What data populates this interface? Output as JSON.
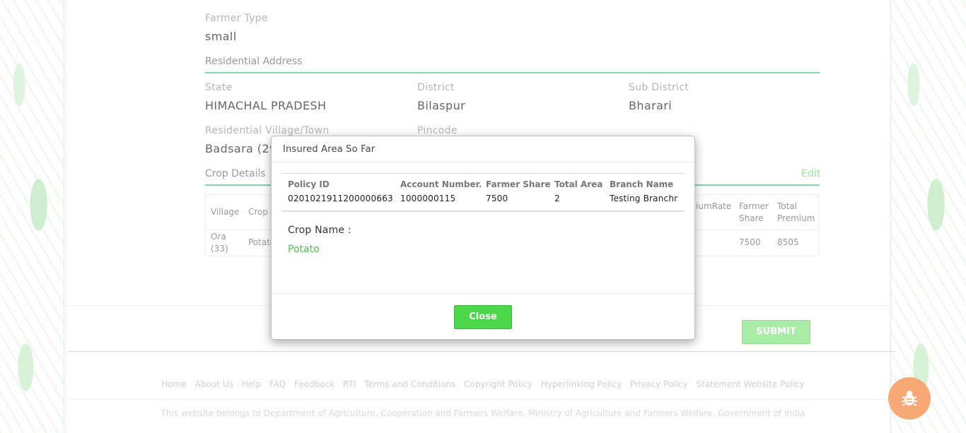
{
  "farmer": {
    "type_label": "Farmer Type",
    "type_value": "small"
  },
  "address": {
    "section_title": "Residential Address",
    "state_label": "State",
    "state_value": "HIMACHAL PRADESH",
    "district_label": "District",
    "district_value": "Bilaspur",
    "subdistrict_label": "Sub District",
    "subdistrict_value": "Bharari",
    "village_label": "Residential Village/Town",
    "village_value": "Badsara (29",
    "pincode_label": "Pincode"
  },
  "crop_details": {
    "section_title": "Crop Details",
    "edit_label": "Edit",
    "columns": [
      "Village",
      "Crop",
      "iumRate",
      "Farmer Share",
      "Total Premium"
    ],
    "row": {
      "village": "Ora (33)",
      "crop": "Potato",
      "farmer_share": "7500",
      "total_premium": "8505"
    }
  },
  "modal": {
    "title": "Insured Area So Far",
    "columns": [
      "Policy ID",
      "Account Number.",
      "Farmer Share",
      "Total Area",
      "Branch Name"
    ],
    "row": [
      "0201021911200000663",
      "1000000115",
      "7500",
      "2",
      "Testing Branchr"
    ],
    "crop_label": "Crop Name :",
    "crop_value": "Potato",
    "close_label": "Close"
  },
  "submit_label": "SUBMIT",
  "footer": {
    "links": [
      "Home",
      "About Us",
      "Help",
      "FAQ",
      "Feedback",
      "RTI",
      "Terms and Conditions",
      "Copyright Policy",
      "Hyperlinking Policy",
      "Privacy Policy",
      "Statement Website Policy"
    ],
    "note": "This website belongs to Department of Agriculture, Cooperation and Farmers Welfare, Ministry of Agriculture and Farmers Welfare, Government of India"
  },
  "icons": {
    "bug": "bug-icon"
  },
  "colors": {
    "accent_green": "#4cd64a",
    "section_line": "#7fd9a9",
    "bug_button": "#f7a874"
  }
}
